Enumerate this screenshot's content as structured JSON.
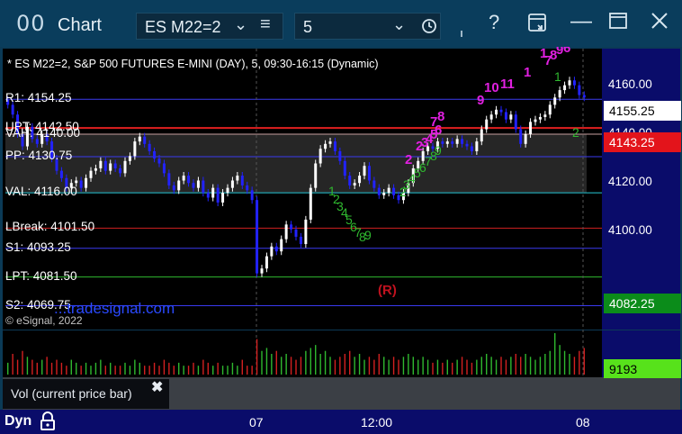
{
  "window": {
    "app_icon": "00",
    "title": "Chart",
    "symbol": "ES M22=2",
    "interval": "5",
    "icons": [
      "chevron-down-icon",
      "menu-icon",
      "clock-icon",
      "help-icon",
      "layout-icon",
      "minimize-icon",
      "maximize-icon",
      "close-icon"
    ]
  },
  "chart": {
    "heading": "* ES M22=2, S&P 500 FUTURES E-MINI (DAY), 5, 09:30-16:15 (Dynamic)",
    "levels": [
      {
        "label": "R1: 4154.25",
        "price": 4154.25,
        "color": "#3a3af0"
      },
      {
        "label": "UPT: 4142.50",
        "price": 4142.5,
        "color": "#e02020"
      },
      {
        "label": "VAH: 4140.00",
        "price": 4140.0,
        "color": "#c8a0a0"
      },
      {
        "label": "PP: 4130.75",
        "price": 4130.75,
        "color": "#3a3af0"
      },
      {
        "label": "VAL: 4116.00",
        "price": 4116.0,
        "color": "#27c9d8"
      },
      {
        "label": "LBreak: 4101.50",
        "price": 4101.5,
        "color": "#d02020"
      },
      {
        "label": "S1: 4093.25",
        "price": 4093.25,
        "color": "#3a3af0"
      },
      {
        "label": "LPT: 4081.50",
        "price": 4081.5,
        "color": "#2fb82f"
      },
      {
        "label": "S2: 4069.75",
        "price": 4069.75,
        "color": "#3a3af0"
      }
    ],
    "price_ticks": [
      "4160.00",
      "4140.00",
      "4120.00",
      "4100.00"
    ],
    "badges": {
      "last": "4155.25",
      "red": "4143.25",
      "green": "4082.25",
      "volume": "9193"
    },
    "time_labels": [
      "07",
      "12:00",
      "08"
    ],
    "corner_label": "Dyn",
    "copyright": "© eSignal, 2022",
    "watermark": "...tradesignal.com",
    "r_marker": "(R)",
    "volume_legend": "Vol (current price bar)",
    "seq_magenta": [
      "9",
      "10",
      "11",
      "1",
      "2",
      "3",
      "4",
      "5",
      "6",
      "7",
      "8",
      "2",
      "7",
      "8",
      "9",
      "1",
      "6"
    ],
    "seq_green": [
      "1",
      "2",
      "3",
      "4",
      "5",
      "6",
      "7",
      "8",
      "9",
      "2",
      "3",
      "4",
      "5",
      "6",
      "7",
      "8",
      "9",
      "1",
      "2"
    ],
    "colors": {
      "up": "#ffffff",
      "down": "#2222ff",
      "background": "#000000",
      "scale": "#0a0c6a"
    }
  },
  "chart_data": {
    "type": "candlestick",
    "ylim": [
      4060,
      4175
    ],
    "y_ticks": [
      4100,
      4120,
      4140,
      4160
    ],
    "x_ticks": [
      "07",
      "12:00",
      "08"
    ],
    "series": [
      {
        "values": [
          4152,
          4148,
          4140,
          4135,
          4143,
          4138,
          4136,
          4140,
          4137,
          4130,
          4125,
          4122,
          4118,
          4120,
          4121,
          4118,
          4122,
          4125,
          4126,
          4129,
          4125,
          4128,
          4126,
          4124,
          4129,
          4131,
          4137,
          4139,
          4136,
          4133,
          4130,
          4128,
          4124,
          4119,
          4117,
          4121,
          4123,
          4120,
          4118,
          4121,
          4116,
          4114,
          4118,
          4112,
          4116,
          4118,
          4121,
          4123,
          4119,
          4117,
          4113,
          4083,
          4085,
          4090,
          4094,
          4092,
          4097,
          4103,
          4101,
          4098,
          4095,
          4105,
          4118,
          4128,
          4134,
          4136,
          4137,
          4133,
          4129,
          4123,
          4119,
          4120,
          4123,
          4127,
          4121,
          4118,
          4115,
          4116,
          4118,
          4115,
          4113,
          4116,
          4120,
          4126,
          4129,
          4133,
          4135,
          4134,
          4137,
          4136,
          4137,
          4136,
          4138,
          4136,
          4135,
          4133,
          4137,
          4142,
          4146,
          4148,
          4150,
          4149,
          4146,
          4148,
          4142,
          4136,
          4140,
          4145,
          4146,
          4147,
          4148,
          4152,
          4155,
          4158,
          4160,
          4162,
          4160,
          4156,
          4155
        ]
      }
    ],
    "volume": [
      4,
      7,
      5,
      8,
      6,
      5,
      4,
      5,
      6,
      4,
      5,
      4,
      3,
      5,
      4,
      3,
      4,
      3,
      4,
      5,
      3,
      4,
      3,
      3,
      4,
      3,
      5,
      4,
      3,
      3,
      4,
      3,
      5,
      4,
      3,
      4,
      3,
      3,
      4,
      3,
      5,
      4,
      3,
      4,
      3,
      3,
      4,
      3,
      5,
      3,
      3,
      12,
      8,
      9,
      7,
      8,
      6,
      7,
      6,
      5,
      6,
      8,
      9,
      10,
      7,
      8,
      6,
      5,
      6,
      7,
      8,
      6,
      7,
      5,
      6,
      5,
      7,
      6,
      5,
      6,
      5,
      6,
      7,
      6,
      5,
      6,
      5,
      4,
      5,
      4,
      5,
      4,
      5,
      6,
      5,
      4,
      5,
      6,
      7,
      6,
      5,
      6,
      5,
      6,
      7,
      6,
      7,
      6,
      5,
      6,
      7,
      8,
      14,
      10,
      8,
      7,
      6,
      8,
      9
    ]
  }
}
